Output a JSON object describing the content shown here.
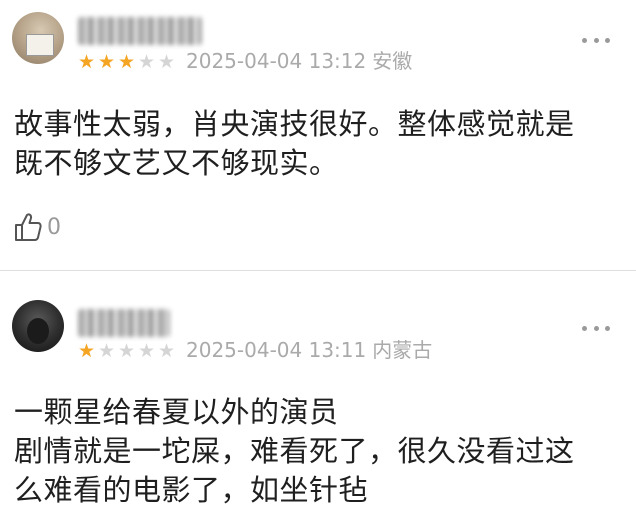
{
  "reviews": [
    {
      "rating": 3,
      "rating_max": 5,
      "date": "2025-04-04 13:12",
      "location": "安徽",
      "text_lines": [
        "故事性太弱，肖央演技很好。整体感觉就是",
        "既不够文艺又不够现实。"
      ],
      "likes": "0",
      "star_color": "#f5a524"
    },
    {
      "rating": 1,
      "rating_max": 5,
      "date": "2025-04-04 13:11",
      "location": "内蒙古",
      "text_lines": [
        "一颗星给春夏以外的演员",
        "剧情就是一坨屎，难看死了，很久没看过这",
        "么难看的电影了，如坐针毡"
      ]
    }
  ]
}
